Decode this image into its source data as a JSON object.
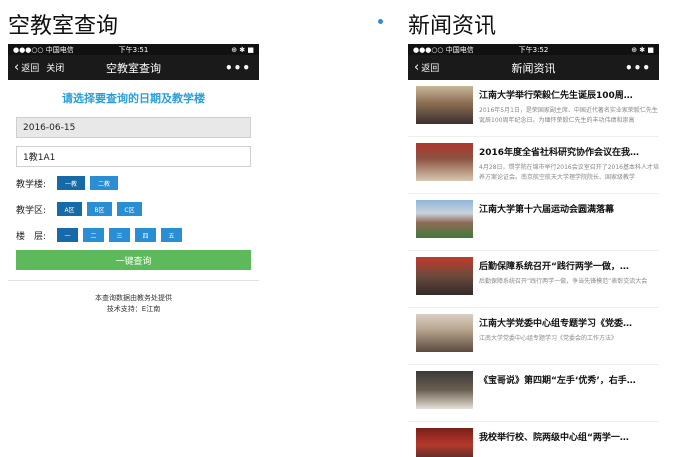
{
  "left": {
    "section_title": "空教室查询",
    "status": {
      "carrier": "●●●○○ 中国电信",
      "time": "下午3:51",
      "battery": "⊕ ✱ ■"
    },
    "navbar": {
      "back": "返回",
      "close": "关闭",
      "title": "空教室查询",
      "more": "•••"
    },
    "heading": "请选择要查询的日期及教学楼",
    "date_value": "2016-06-15",
    "building_value": "1教1A1",
    "building_label": "教学楼:",
    "buildings": [
      "一教",
      "二教"
    ],
    "zone_label": "教学区:",
    "zones": [
      "A区",
      "B区",
      "C区"
    ],
    "floor_label": "楼　层:",
    "floors": [
      "一",
      "二",
      "三",
      "四",
      "五"
    ],
    "submit": "一键查询",
    "footer_line1": "本查询数据由教务处提供",
    "footer_line2": "技术支持：E江南"
  },
  "right": {
    "section_title": "新闻资讯",
    "status": {
      "carrier": "●●●○○ 中国电信",
      "time": "下午3:52",
      "battery": "⊕ ✱ ■"
    },
    "navbar": {
      "back": "返回",
      "title": "新闻资讯",
      "more": "•••"
    },
    "news": [
      {
        "title": "江南大学举行荣毅仁先生诞辰100周…",
        "snippet": "2016年5月1日，是荣国家副主席、中国近代著名实业家荣毅仁先生诞辰100周年纪念日。为缅怀荣毅仁先生的丰功伟绩和崇高"
      },
      {
        "title": "2016年度全省社科研究协作会议在我…",
        "snippet": "4月28日，瓒学院在锦市举行2016会议室召开了2016基本科人才培养方案论证会。南京航空航天大学理学院院长、国家级教学"
      },
      {
        "title": "江南大学第十六届运动会圆满落幕",
        "snippet": ""
      },
      {
        "title": "后勤保障系统召开“践行两学一做，…",
        "snippet": "后勤保障系统召开“践行两学一做，争当先锋模范”表彰交流大会"
      },
      {
        "title": "江南大学党委中心组专题学习《党委…",
        "snippet": "江南大学党委中心组专题学习《党委会的工作方法》"
      },
      {
        "title": "《宝哥说》第四期“左手‘优秀’，右手…",
        "snippet": ""
      },
      {
        "title": "我校举行校、院两级中心组“两学一…",
        "snippet": ""
      }
    ]
  }
}
